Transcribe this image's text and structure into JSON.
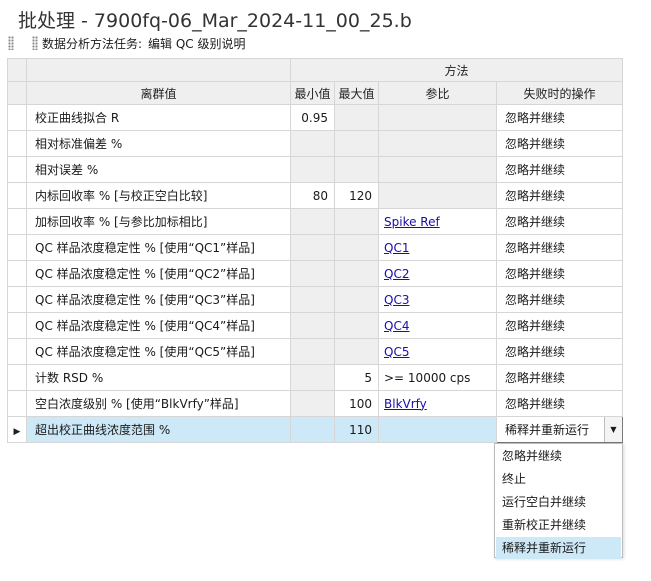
{
  "window": {
    "title": "批处理 - 7900fq-06_Mar_2024-11_00_25.b"
  },
  "toolbar": {
    "label": "数据分析方法任务:",
    "item": "编辑 QC 级别说明"
  },
  "table": {
    "group_header": "方法",
    "headers": {
      "name": "离群值",
      "min": "最小值",
      "max": "最大值",
      "ref": "参比",
      "action": "失败时的操作"
    },
    "rows": [
      {
        "name": "校正曲线拟合 R",
        "min": "0.95",
        "max": "",
        "ref": "",
        "action": "忽略并继续"
      },
      {
        "name": "相对标准偏差 %",
        "min": "",
        "max": "",
        "ref": "",
        "action": "忽略并继续"
      },
      {
        "name": "相对误差 %",
        "min": "",
        "max": "",
        "ref": "",
        "action": "忽略并继续"
      },
      {
        "name": "内标回收率 %  [与校正空白比较]",
        "min": "80",
        "max": "120",
        "ref": "",
        "action": "忽略并继续"
      },
      {
        "name": "加标回收率 %  [与参比加标相比]",
        "min": "",
        "max": "",
        "ref": "Spike Ref",
        "action": "忽略并继续"
      },
      {
        "name": "QC 样品浓度稳定性 %  [使用“QC1”样品]",
        "min": "",
        "max": "",
        "ref": "QC1",
        "action": "忽略并继续"
      },
      {
        "name": "QC 样品浓度稳定性 %  [使用“QC2”样品]",
        "min": "",
        "max": "",
        "ref": "QC2",
        "action": "忽略并继续"
      },
      {
        "name": "QC 样品浓度稳定性 %  [使用“QC3”样品]",
        "min": "",
        "max": "",
        "ref": "QC3",
        "action": "忽略并继续"
      },
      {
        "name": "QC 样品浓度稳定性 %  [使用“QC4”样品]",
        "min": "",
        "max": "",
        "ref": "QC4",
        "action": "忽略并继续"
      },
      {
        "name": "QC 样品浓度稳定性 %  [使用“QC5”样品]",
        "min": "",
        "max": "",
        "ref": "QC5",
        "action": "忽略并继续"
      },
      {
        "name": "计数 RSD %",
        "min": "",
        "max": "5",
        "ref": ">= 10000 cps",
        "action": "忽略并继续"
      },
      {
        "name": "空白浓度级别 %  [使用“BlkVrfy”样品]",
        "min": "",
        "max": "100",
        "ref": "BlkVrfy",
        "action": "忽略并继续"
      },
      {
        "name": "超出校正曲线浓度范围 %",
        "min": "",
        "max": "110",
        "ref": "",
        "action": "稀释并重新运行"
      }
    ]
  },
  "dropdown": {
    "options": [
      "忽略并继续",
      "终止",
      "运行空白并继续",
      "重新校正并继续",
      "稀释并重新运行"
    ],
    "selected": "稀释并重新运行"
  }
}
